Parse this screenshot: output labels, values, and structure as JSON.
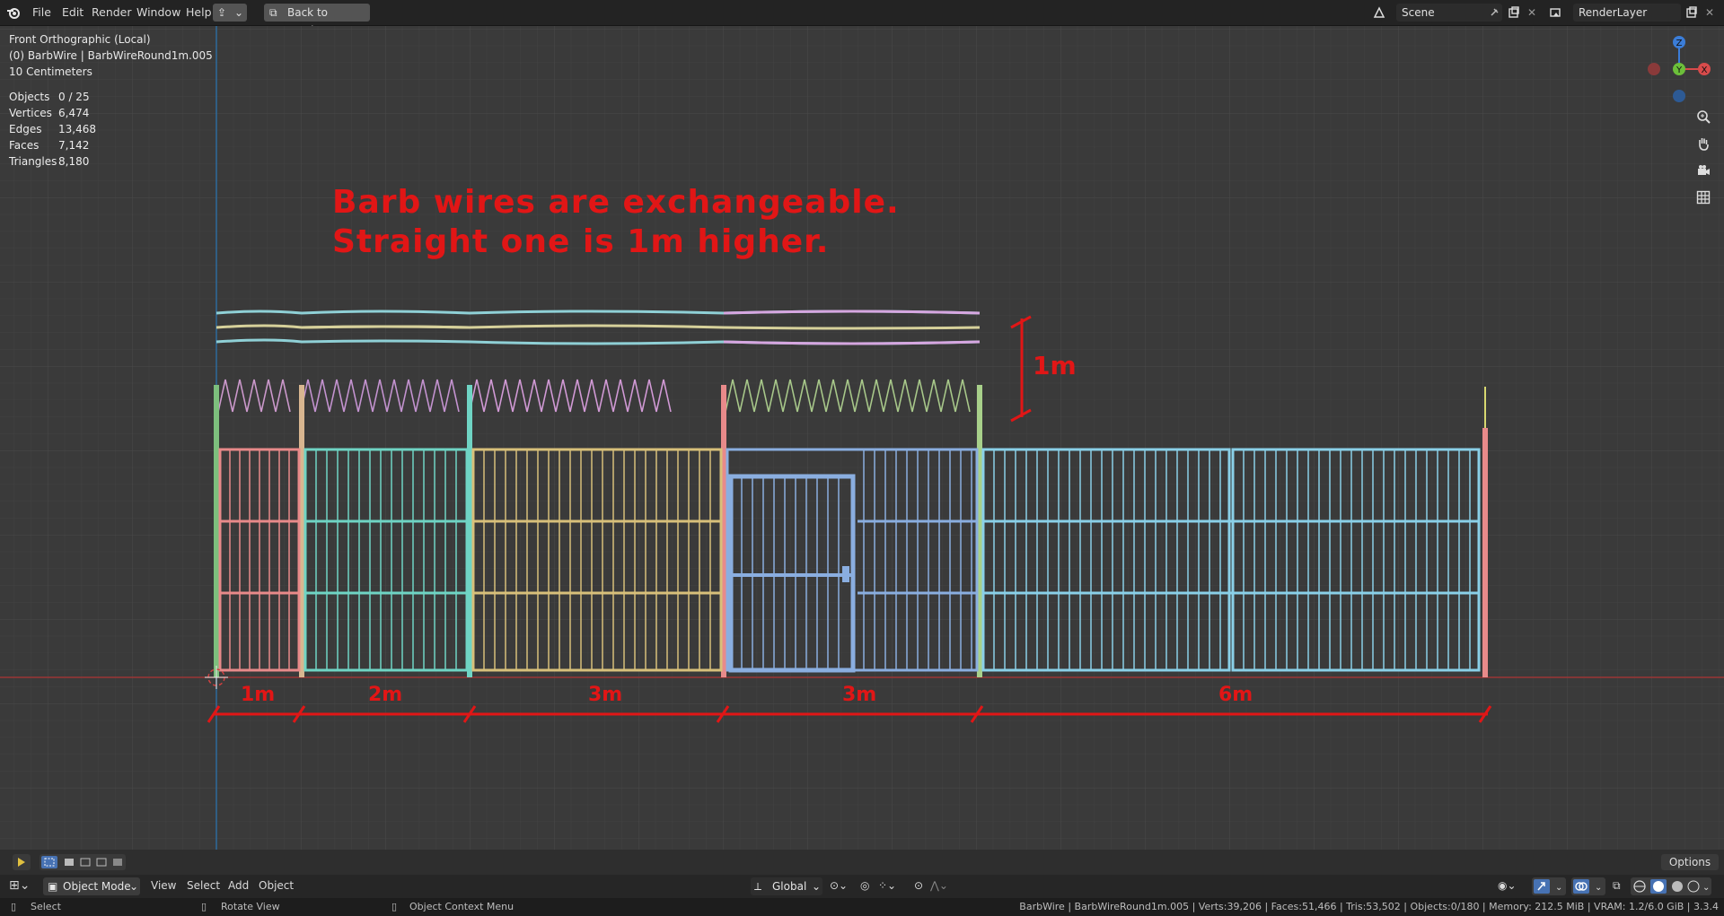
{
  "menu": {
    "items": [
      "File",
      "Edit",
      "Render",
      "Window",
      "Help"
    ],
    "back_button": "Back to Previous"
  },
  "scene": {
    "name": "Scene",
    "render_layer": "RenderLayer"
  },
  "viewport": {
    "view_name": "Front Orthographic (Local)",
    "object_name": "(0) BarbWire | BarbWireRound1m.005",
    "scale": "10 Centimeters",
    "stats": [
      {
        "label": "Objects",
        "value": "0 / 25"
      },
      {
        "label": "Vertices",
        "value": "6,474"
      },
      {
        "label": "Edges",
        "value": "13,468"
      },
      {
        "label": "Faces",
        "value": "7,142"
      },
      {
        "label": "Triangles",
        "value": "8,180"
      }
    ],
    "annotation": [
      "Barb wires are exchangeable.",
      "Straight one is 1m higher."
    ],
    "height_label": "1m",
    "segment_labels": [
      "1m",
      "2m",
      "3m",
      "3m",
      "6m"
    ],
    "gizmo": {
      "z": "Z",
      "y": "Y",
      "x": "X"
    }
  },
  "header": {
    "mode": "Object Mode",
    "menus": [
      "View",
      "Select",
      "Add",
      "Object"
    ],
    "transform": "Global",
    "options": "Options"
  },
  "status": {
    "select": "Select",
    "rotate": "Rotate View",
    "context": "Object Context Menu",
    "info": "BarbWire | BarbWireRound1m.005 | Verts:39,206 | Faces:51,466 | Tris:53,502 | Objects:0/180 | Memory: 212.5 MiB | VRAM: 1.2/6.0 GiB | 3.3.4"
  },
  "colors": {
    "accent_red": "#e11616",
    "panel_green": "#7dbf7d",
    "panel_red": "#e88a8a",
    "panel_cyan": "#6fd4c4",
    "panel_yellow": "#d8c07a",
    "panel_blue": "#8aaee0",
    "panel_lightblue": "#8ad0e8"
  }
}
